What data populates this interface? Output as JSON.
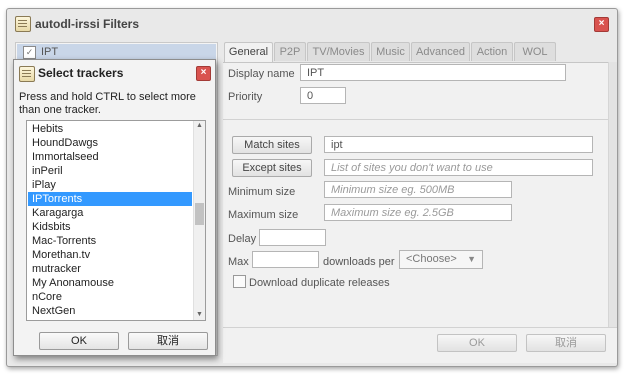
{
  "window": {
    "title": "autodl-irssi Filters"
  },
  "filters": [
    {
      "name": "IPT",
      "enabled": true
    }
  ],
  "tabs": [
    "General",
    "P2P",
    "TV/Movies",
    "Music",
    "Advanced",
    "Action",
    "WOL"
  ],
  "general": {
    "display_name_label": "Display name",
    "display_name_value": "IPT",
    "priority_label": "Priority",
    "priority_value": "0",
    "match_sites_button": "Match sites",
    "match_sites_value": "ipt",
    "except_sites_button": "Except sites",
    "except_sites_placeholder": "List of sites you don't want to use",
    "min_size_label": "Minimum size",
    "min_size_placeholder": "Minimum size eg. 500MB",
    "max_size_label": "Maximum size",
    "max_size_placeholder": "Maximum size eg. 2.5GB",
    "delay_label": "Delay",
    "max_label": "Max",
    "downloads_per_label": "downloads per",
    "downloads_per_value": "<Choose>",
    "download_duplicates_label": "Download duplicate releases"
  },
  "footer": {
    "ok": "OK",
    "cancel": "取消"
  },
  "dialog": {
    "title": "Select trackers",
    "message": "Press and hold CTRL to select more than one tracker.",
    "trackers": [
      "Hebits",
      "HoundDawgs",
      "Immortalseed",
      "inPeril",
      "iPlay",
      "IPTorrents",
      "Karagarga",
      "Kidsbits",
      "Mac-Torrents",
      "Morethan.tv",
      "mutracker",
      "My Anonamouse",
      "nCore",
      "NextGen"
    ],
    "selected": "IPTorrents",
    "ok": "OK",
    "cancel": "取消"
  }
}
